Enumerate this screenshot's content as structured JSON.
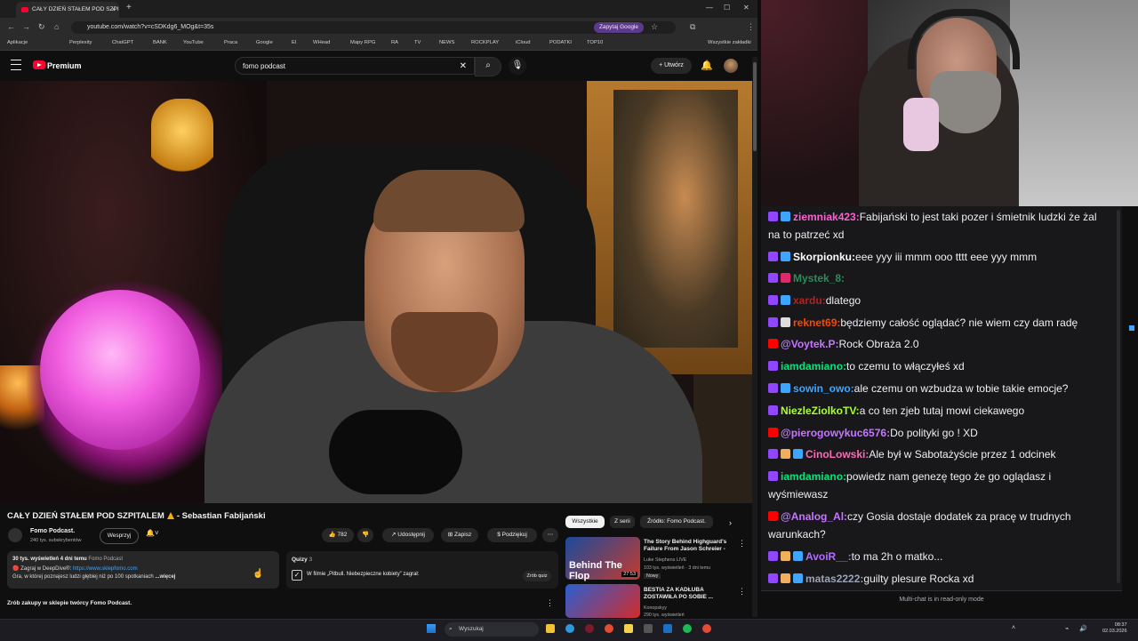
{
  "browser": {
    "tab_title": "CAŁY DZIEŃ STAŁEM POD SZPI",
    "url": "youtube.com/watch?v=cSDKdg6_MOg&t=35s",
    "ask_google": "Zapytaj Google",
    "bookmarks": [
      "Aplikacje",
      "Perplexity",
      "ChatGPT",
      "BANK",
      "YouTube",
      "Praca",
      "Google",
      "EI",
      "WHead",
      "Mapy RPG",
      "RA",
      "TV",
      "NEWS",
      "ROCKPLAY",
      "iCloud",
      "PODATKI",
      "TOP10"
    ],
    "all_bookmarks": "Wszystkie zakładki"
  },
  "youtube": {
    "logo_text": "Premium",
    "search_value": "fomo podcast",
    "create_label": "Utwórz",
    "video_title": "CAŁY DZIEŃ STAŁEM POD SZPITALEM",
    "video_title_suffix": "- Sebastian Fabijański",
    "channel_name": "Fomo Podcast.",
    "subscribers": "240 tys. subskrybentów",
    "support_label": "Wesprzyj",
    "likes": "782",
    "share_label": "Udostępnij",
    "save_label": "Zapisz",
    "thanks_label": "Podziękuj",
    "desc_stats": "30 tys. wyświetleń  4 dni temu",
    "desc_channel": "Fomo Podcast",
    "desc_line2_prefix": "🔴 Zagraj w DeepDive®:",
    "desc_link": "https://www.sklepfomo.com",
    "desc_line3": "Gra, w której poznajesz ludzi głębiej niż po 100 spotkaniach",
    "desc_more": "...więcej",
    "quiz_header": "Quizy",
    "quiz_count": "3",
    "quiz_question": "W filmie „Pitbull. Niebezpieczne kobiety” zagrał:",
    "quiz_button": "Zrób quiz",
    "shop_label": "Zrób zakupy w sklepie twórcy Fomo Podcast.",
    "chips": [
      "Wszystkie",
      "Z serii",
      "Źródło: Fomo Podcast."
    ],
    "recommended": [
      {
        "title": "The Story Behind Highguard's Failure From Jason Schreier -",
        "channel": "Luke Stephens LIVE",
        "meta": "103 tys. wyświetleń · 3 dni temu",
        "badge": "Nowy",
        "duration": "27:53",
        "thumb_text": "Behind The Flop"
      },
      {
        "title": "BESTIA ZA KADŁUBA ZOSTAWIŁA PO SOBIE ...",
        "channel": "Konopskyy",
        "meta": "290 tys. wyświetleń",
        "badge": "",
        "duration": "",
        "thumb_text": ""
      }
    ]
  },
  "taskbar": {
    "search_placeholder": "Wyszukaj",
    "time": "08:37",
    "date": "02.03.2026"
  },
  "chat": {
    "messages": [
      {
        "badges": [
          "twitch",
          "sub"
        ],
        "nick": "ziemniak423:",
        "nick_color": "#ff5fd2",
        "text": "Fabijański to jest taki pozer i śmietnik ludzki że żal na to patrzeć xd"
      },
      {
        "badges": [
          "twitch",
          "sub"
        ],
        "nick": "Skorpionku:",
        "nick_color": "#ffffff",
        "text": "eee yyy iii mmm ooo tttt eee yyy mmm"
      },
      {
        "badges": [
          "twitch",
          "heart"
        ],
        "nick": "Mystek_8:",
        "nick_color": "#2e8b57",
        "text": ""
      },
      {
        "badges": [
          "twitch",
          "sub"
        ],
        "nick": "xardu:",
        "nick_color": "#b22222",
        "text": "dlatego"
      },
      {
        "badges": [
          "twitch",
          "skull"
        ],
        "nick": "reknet69:",
        "nick_color": "#ff4500",
        "text": "będziemy całość oglądać? nie wiem czy dam radę"
      },
      {
        "badges": [
          "youtube"
        ],
        "nick": "@Voytek.P:",
        "nick_color": "#c576ff",
        "text": "Rock Obraża 2.0"
      },
      {
        "badges": [
          "twitch"
        ],
        "nick": "iamdamiano:",
        "nick_color": "#00e67a",
        "text": "to czemu to włączyłeś xd"
      },
      {
        "badges": [
          "twitch",
          "sub"
        ],
        "nick": "sowin_owo:",
        "nick_color": "#3ea6ff",
        "text": "ale czemu on wzbudza w tobie takie emocje?"
      },
      {
        "badges": [
          "twitch"
        ],
        "nick": "NiezleZiolkoTV:",
        "nick_color": "#adff2f",
        "text": "a co ten zjeb tutaj mowi ciekawego"
      },
      {
        "badges": [
          "youtube"
        ],
        "nick": "@pierogowykuc6576:",
        "nick_color": "#c576ff",
        "text": "Do polityki go ! XD"
      },
      {
        "badges": [
          "twitch",
          "face",
          "sub"
        ],
        "nick": "CinoLowski:",
        "nick_color": "#ff69b4",
        "text": "Ale był w Sabotażyście przez 1 odcinek"
      },
      {
        "badges": [
          "twitch"
        ],
        "nick": "iamdamiano:",
        "nick_color": "#00e67a",
        "text": "powiedz nam genezę tego że go oglądasz i wyśmiewasz"
      },
      {
        "badges": [
          "youtube"
        ],
        "nick": "@Analog_Al:",
        "nick_color": "#c576ff",
        "text": "czy Gosia dostaje dodatek za pracę w trudnych warunkach?"
      },
      {
        "badges": [
          "twitch",
          "face",
          "sub"
        ],
        "nick": "AvoiR__:",
        "nick_color": "#b36bff",
        "text": "to ma 2h o matko..."
      },
      {
        "badges": [
          "twitch",
          "face",
          "sub"
        ],
        "nick": "matas2222:",
        "nick_color": "#9aa3b5",
        "text": "guilty plesure Rocka xd"
      }
    ],
    "footer": "Multi-chat is in read-only mode"
  }
}
